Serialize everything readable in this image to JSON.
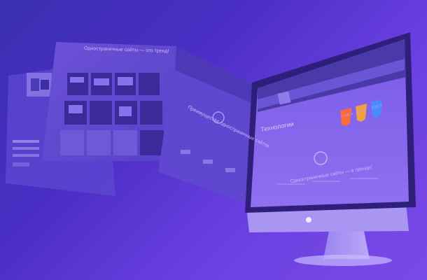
{
  "panel": {
    "title": "Одностраничные сайты — это тренд!",
    "subtitle": "Преимущества одностраничных сайтов"
  },
  "monitor": {
    "heading": "Технологии",
    "banner": "Одностраничные сайты — в тренде!",
    "badges": [
      "HTML 5",
      "CSS 3",
      "CSS 3"
    ]
  },
  "colors": {
    "background": "#4b30c7",
    "accent": "#7c55ef",
    "html_badge": "#ff6a3d",
    "css_badge": "#4a8cff"
  }
}
